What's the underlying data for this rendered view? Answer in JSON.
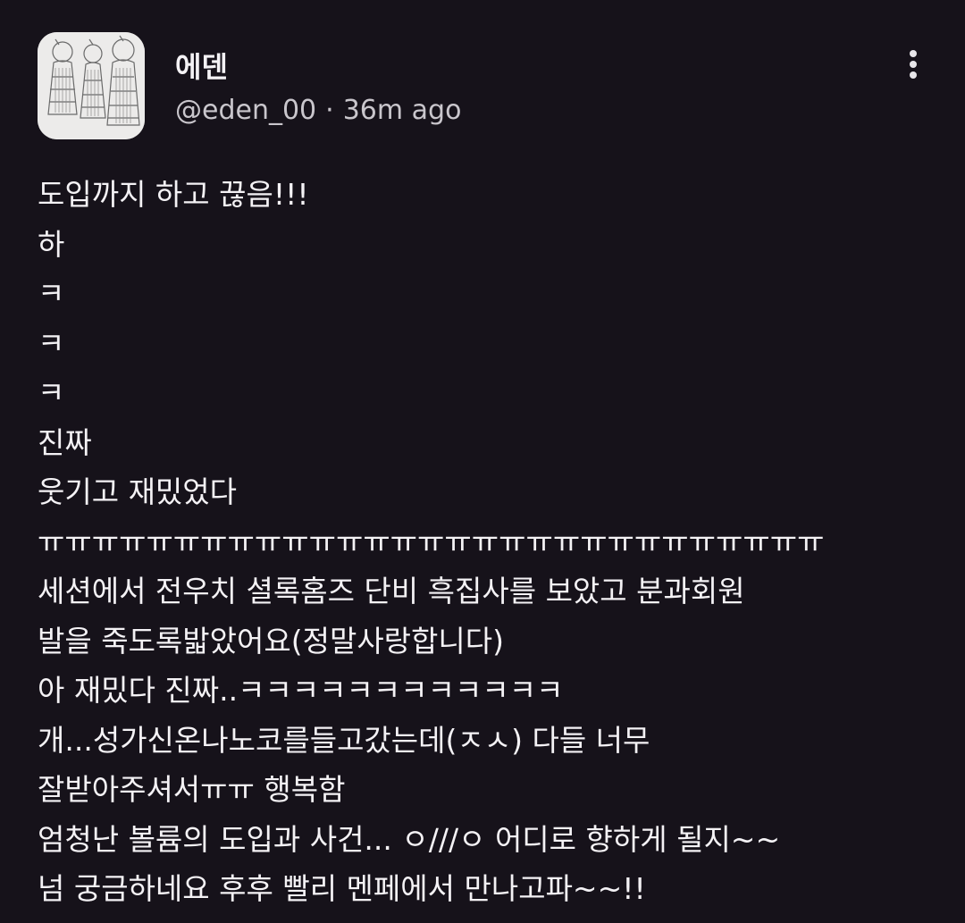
{
  "post": {
    "author_name": "에덴",
    "handle": "@eden_00",
    "separator": "·",
    "time_ago": "36m ago",
    "more_icon": "more-vertical-icon",
    "lines": [
      "도입까지 하고 끊음!!!",
      "하",
      "ㅋ",
      "ㅋ",
      "ㅋ",
      "진짜",
      "웃기고 재밌었다",
      "ㅠㅠㅠㅠㅠㅠㅠㅠㅠㅠㅠㅠㅠㅠㅠㅠㅠㅠㅠㅠㅠㅠㅠㅠㅠㅠㅠㅠㅠ",
      "세션에서 전우치 셜록홈즈 단비 흑집사를 보았고 분과회원",
      "발을 죽도록밟았어요(정말사랑합니다)",
      "아 재밌다 진짜..ㅋㅋㅋㅋㅋㅋㅋㅋㅋㅋㅋㅋ",
      "개...성가신온나노코를들고갔는데(ㅈㅅ) 다들 너무",
      "잘받아주셔서ㅠㅠ 행복함",
      "엄청난 볼륨의 도입과 사건... ㅇ///ㅇ 어디로 향하게 될지~~",
      "넘 궁금하네요 후후 빨리 멘페에서 만나고파~~!!"
    ]
  },
  "colors": {
    "background": "#16121a",
    "text": "#f4f2f5",
    "meta_text": "#c9c6cc"
  }
}
